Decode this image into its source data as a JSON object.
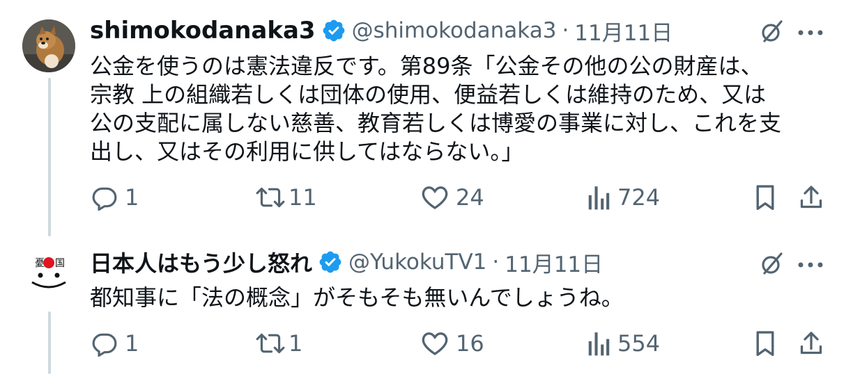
{
  "tweets": [
    {
      "name": "shimokodanaka3",
      "handle": "@shimokodanaka3",
      "separator": "·",
      "date": "11月11日",
      "text": "公金を使うのは憲法違反です。第89条「公金その他の公の財産は、\n宗教 上の組織若しくは団体の使用、便益若しくは維持のため、又は\n公の支配に属しない慈善、教育若しくは博愛の事業に対し、これを支\n出し、又はその利用に供してはならない。」",
      "replies": "1",
      "reposts": "11",
      "likes": "24",
      "views": "724"
    },
    {
      "name": "日本人はもう少し怒れ",
      "handle": "@YukokuTV1",
      "separator": "·",
      "date": "11月11日",
      "avatar_text": "憂国",
      "text": "都知事に「法の概念」がそもそも無いんでしょうね。",
      "replies": "1",
      "reposts": "1",
      "likes": "16",
      "views": "554"
    }
  ],
  "colors": {
    "verified": "#1d9bf0",
    "secondary": "#536471",
    "thread_line": "#cfd9de",
    "avatar_red": "#e0141e"
  }
}
